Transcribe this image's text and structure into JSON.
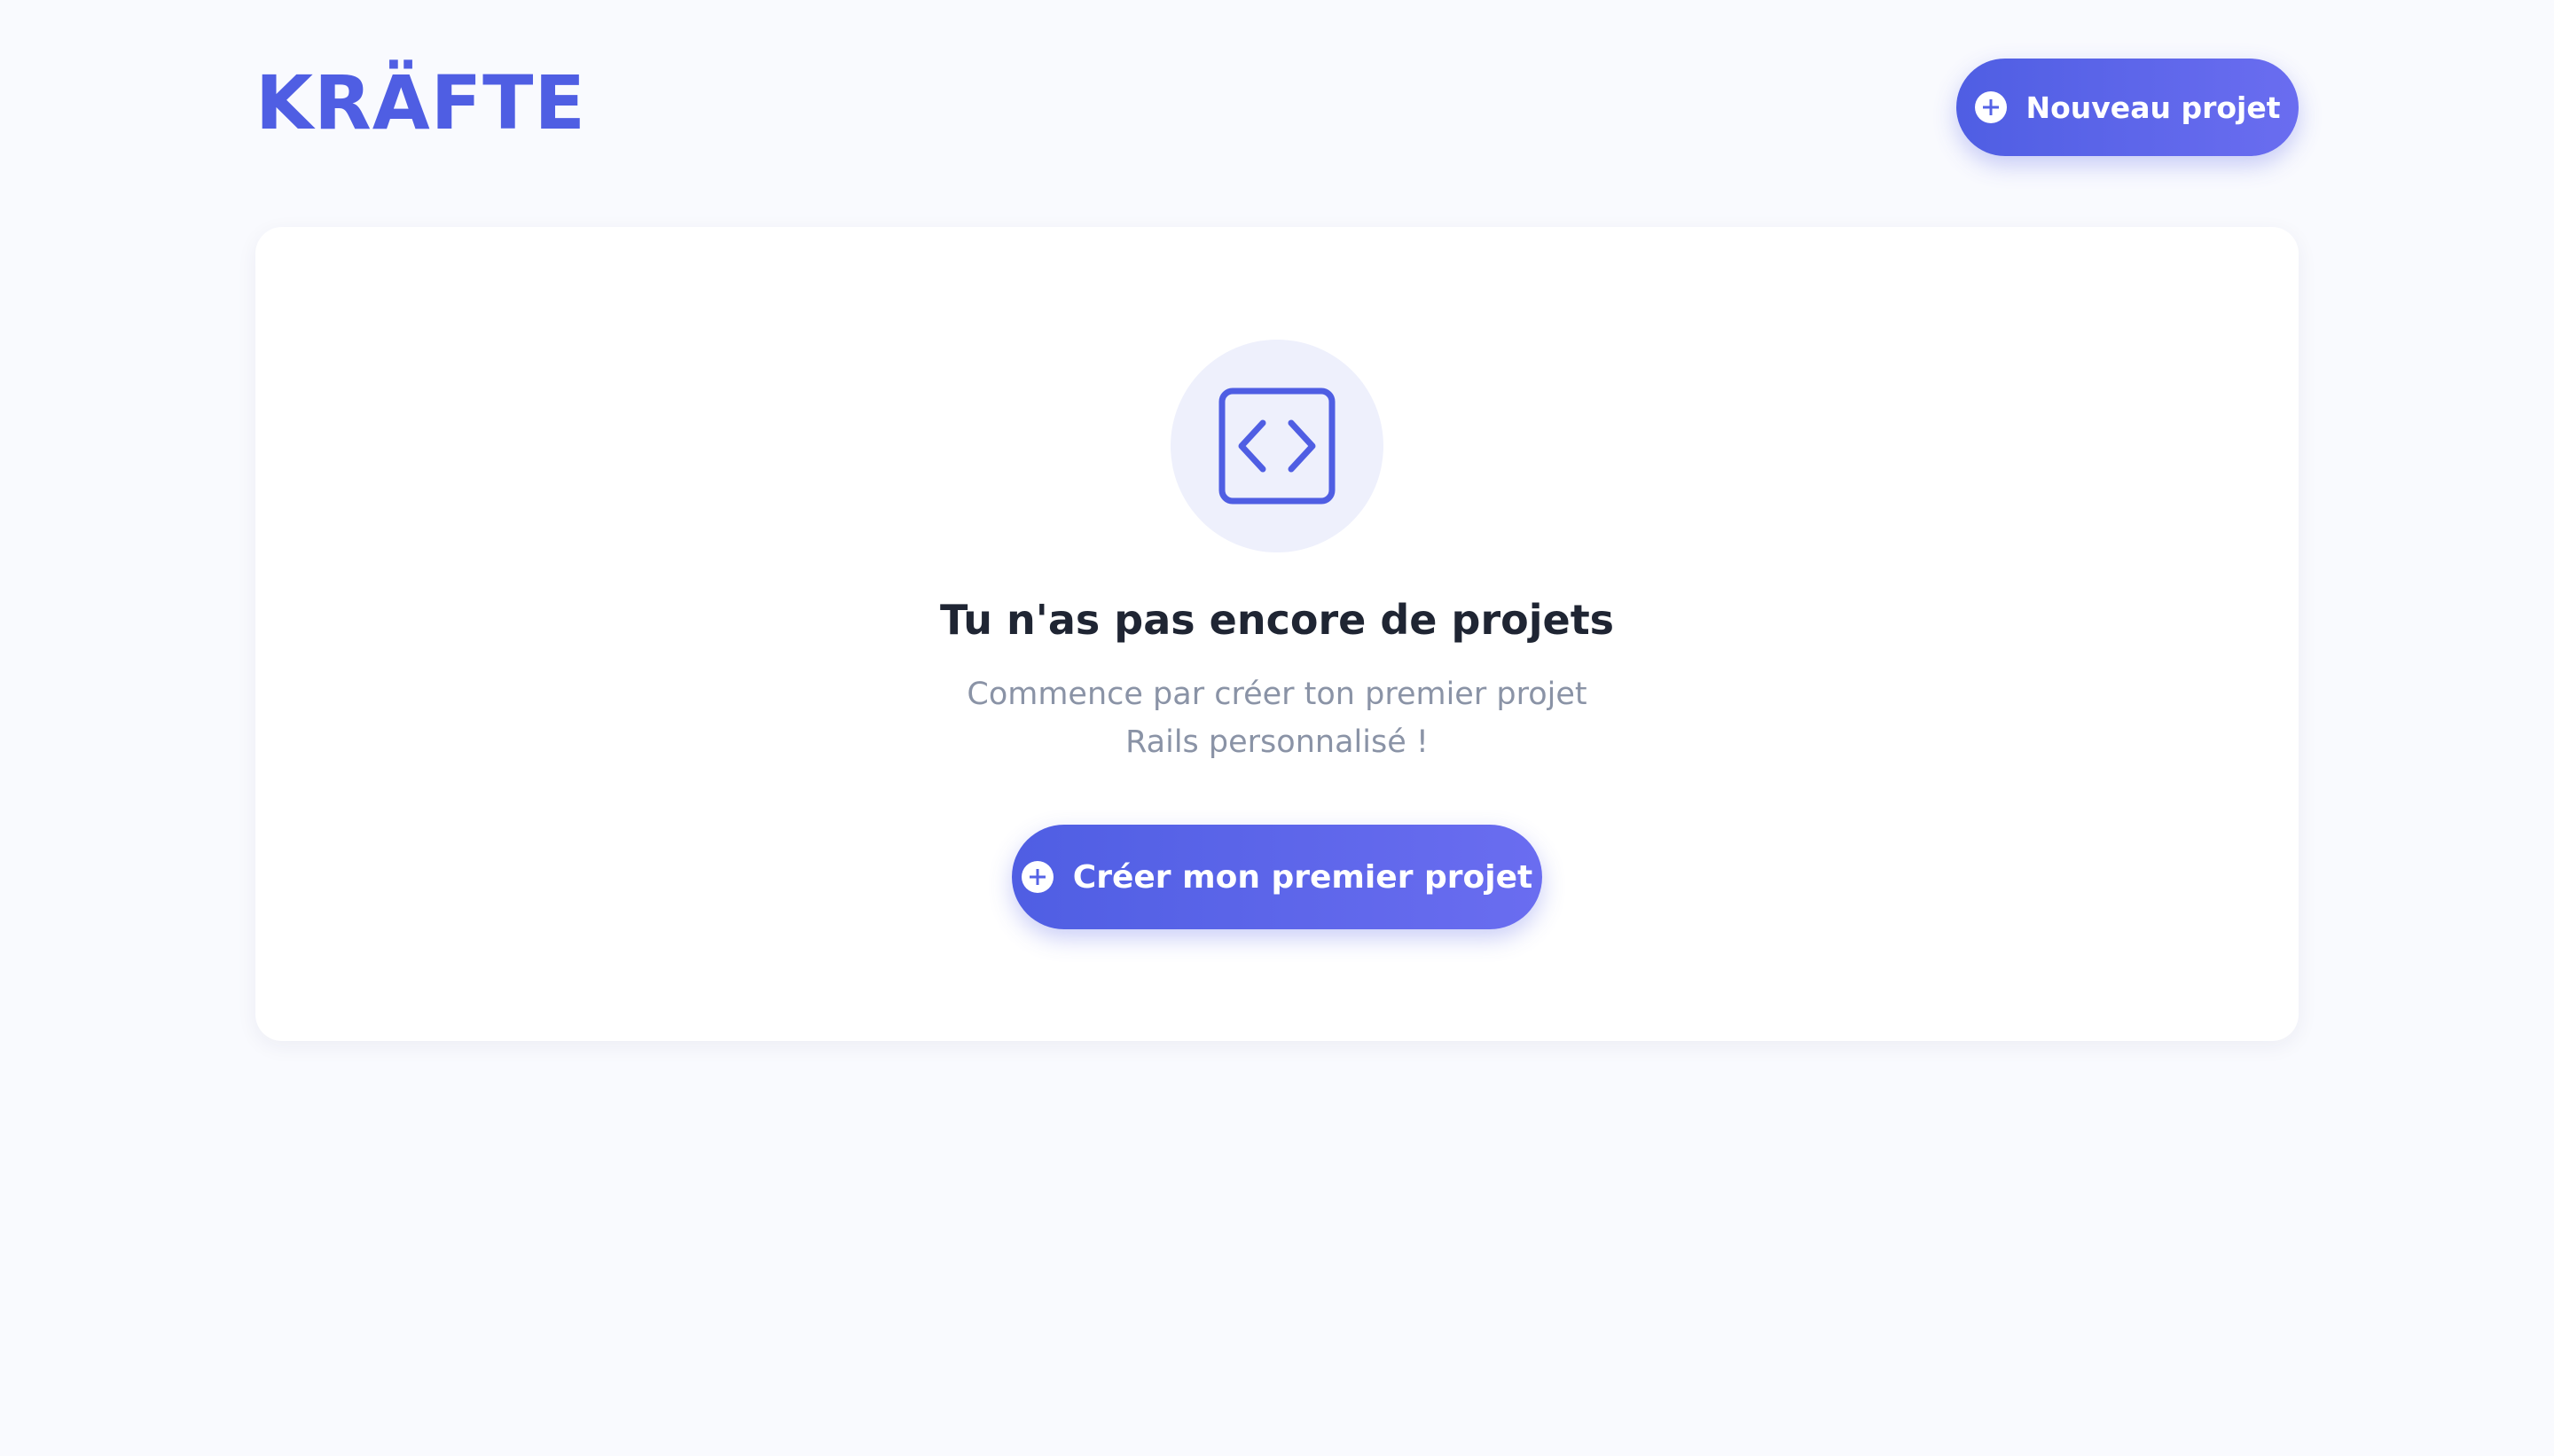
{
  "header": {
    "logo": "KRÄFTE",
    "new_project_label": "Nouveau projet"
  },
  "empty_state": {
    "icon": "code-icon",
    "title": "Tu n'as pas encore de projets",
    "subtitle": "Commence par créer ton premier projet Rails personnalisé !",
    "cta_label": "Créer mon premier projet"
  },
  "colors": {
    "accent": "#4f5ee3",
    "accent_light": "#6a6df0",
    "background": "#f9fafe",
    "card": "#ffffff",
    "icon_bg": "#eef0fc",
    "title_text": "#1f2533",
    "muted_text": "#8a93a6"
  }
}
